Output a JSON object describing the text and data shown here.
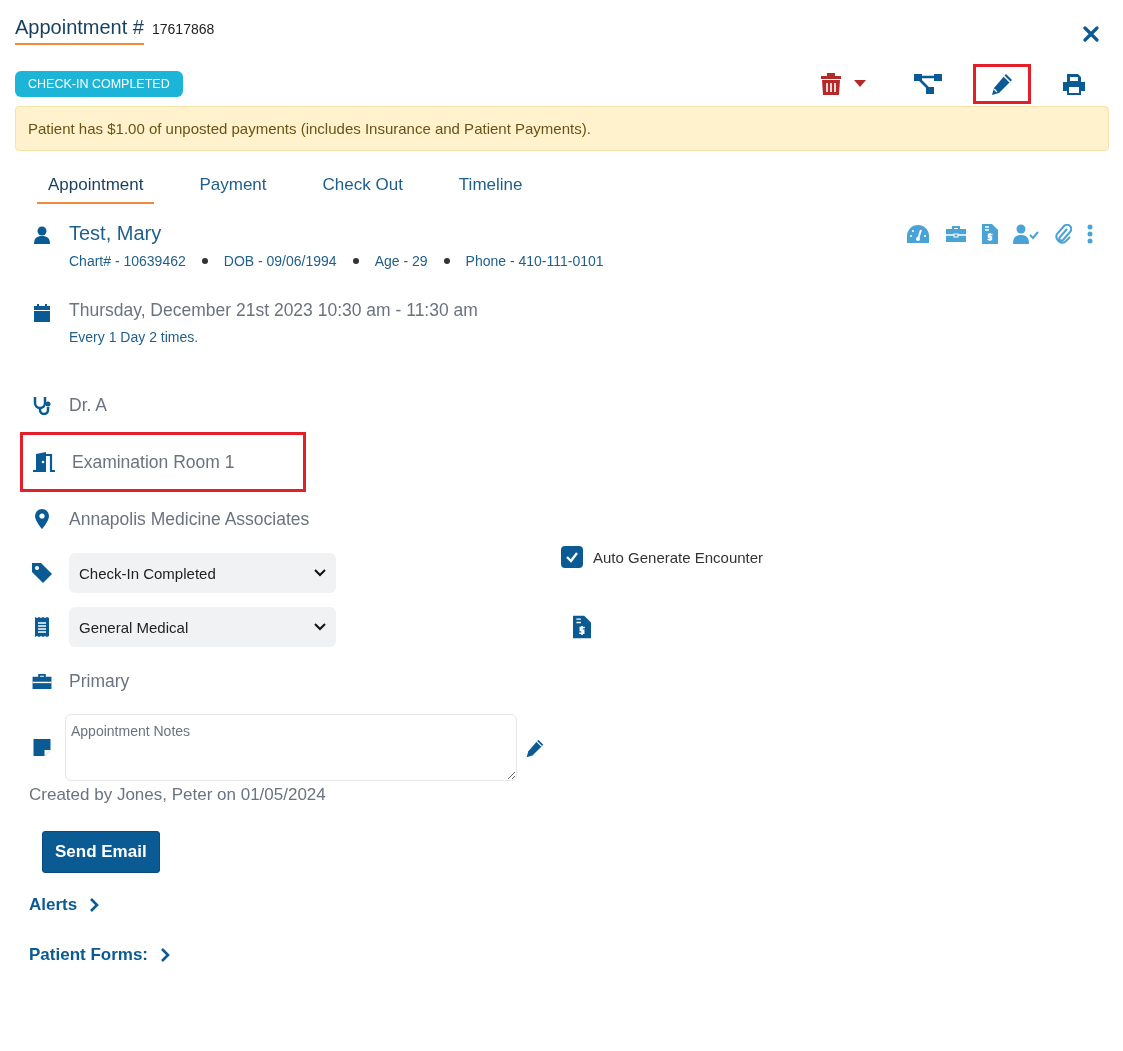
{
  "title": "Appointment #",
  "appointment_number": "17617868",
  "status_badge": "CHECK-IN COMPLETED",
  "toolbar": [
    {
      "kind": "delete",
      "highlighted": false
    },
    {
      "kind": "workflow",
      "highlighted": false
    },
    {
      "kind": "edit",
      "highlighted": true
    },
    {
      "kind": "print",
      "highlighted": false
    }
  ],
  "alert": "Patient has $1.00 of unposted payments (includes Insurance and Patient Payments).",
  "tabs": [
    {
      "label": "Appointment",
      "selected": true
    },
    {
      "label": "Payment",
      "selected": false
    },
    {
      "label": "Check Out",
      "selected": false
    },
    {
      "label": "Timeline",
      "selected": false
    }
  ],
  "patient": {
    "name": "Test, Mary",
    "details": [
      "Chart# - 10639462",
      "DOB - 09/06/1994",
      "Age - 29",
      "Phone - 410-111-0101"
    ],
    "actions": [
      {
        "kind": "dashboard"
      },
      {
        "kind": "briefcase"
      },
      {
        "kind": "bill"
      },
      {
        "kind": "user-check"
      },
      {
        "kind": "paperclip"
      },
      {
        "kind": "more"
      }
    ]
  },
  "schedule": {
    "datetime": "Thursday, December 21st 2023 10:30 am - 11:30 am",
    "recurrence": "Every 1 Day 2 times."
  },
  "provider": "Dr. A",
  "room": {
    "text": "Examination Room 1",
    "highlighted": true
  },
  "location": "Annapolis Medicine Associates",
  "status_select": {
    "value": "Check-In Completed"
  },
  "auto_generate": {
    "label": "Auto Generate Encounter",
    "checked": true
  },
  "visit_type_select": {
    "value": "General Medical"
  },
  "insurance": "Primary",
  "notes": {
    "placeholder": "Appointment Notes"
  },
  "created": "Created by Jones, Peter on 01/05/2024",
  "send_email": "Send Email",
  "sections": [
    {
      "label": "Alerts"
    },
    {
      "label": "Patient Forms:"
    }
  ]
}
